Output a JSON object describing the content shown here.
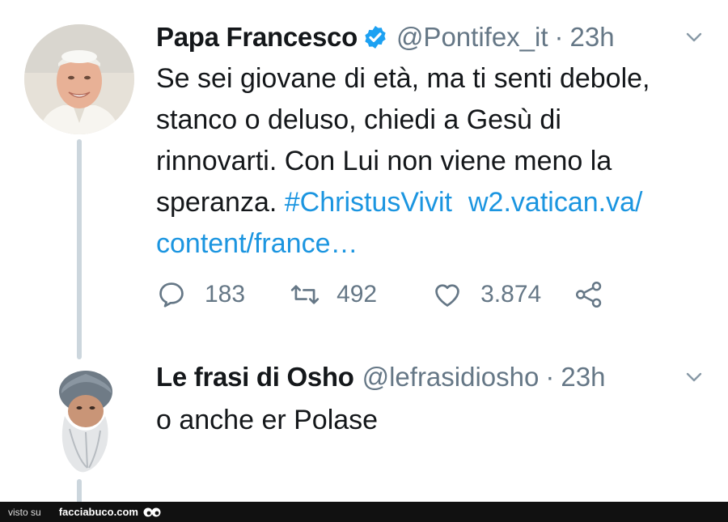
{
  "tweets": [
    {
      "name": "Papa Francesco",
      "handle": "@Pontifex_it",
      "separator": "·",
      "time": "23h",
      "verified": true,
      "text_lines": [
        "Se sei giovane di età, ma ti senti debole,",
        "stanco o deluso, chiedi a Gesù di",
        "rinnovarti. Con Lui non viene meno la"
      ],
      "last_line_text": "speranza. ",
      "hashtag": "#ChristusVivit",
      "link_part1": "w2.vatican.va/",
      "link_part2": "content/france…",
      "replies": "183",
      "retweets": "492",
      "likes": "3.874"
    },
    {
      "name": "Le frasi di Osho",
      "handle": "@lefrasidiosho",
      "separator": "·",
      "time": "23h",
      "text": "o anche er Polase"
    }
  ],
  "footer": {
    "prefix": "visto su",
    "brand": "facciabuco.com"
  },
  "colors": {
    "link": "#1b95e0",
    "secondary": "#657786",
    "verified": "#1da1f2",
    "thread_line": "#ccd6dd"
  }
}
